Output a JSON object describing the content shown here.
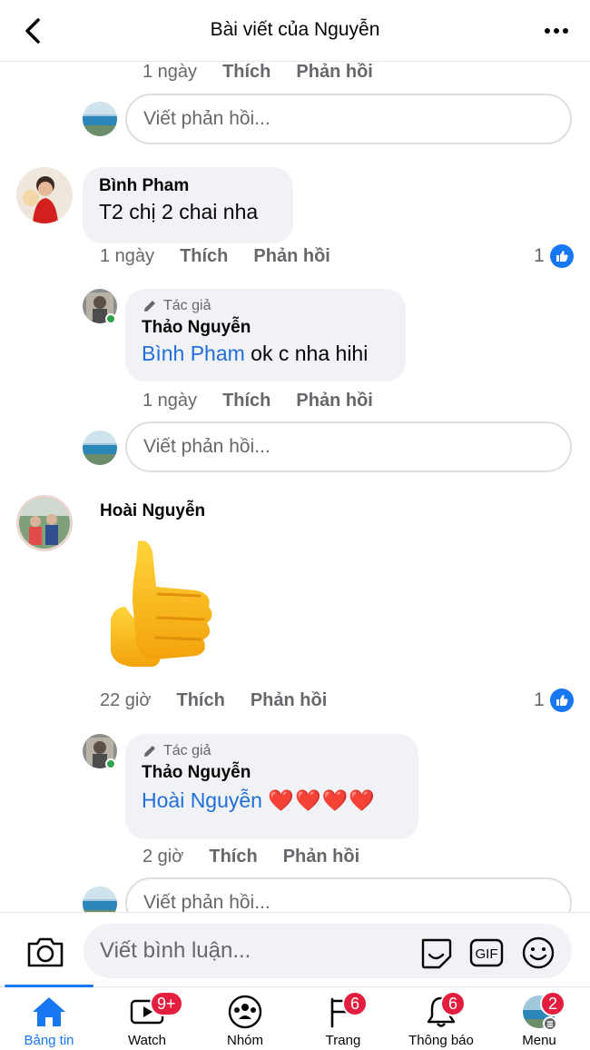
{
  "header": {
    "title": "Bài viết của Nguyễn"
  },
  "thread": {
    "top_meta": {
      "time": "1 ngày",
      "like": "Thích",
      "reply": "Phản hồi"
    },
    "reply_placeholder": "Viết phản hồi...",
    "comment1": {
      "name": "Bình Pham",
      "text": "T2 chị 2 chai nha",
      "time": "1 ngày",
      "like": "Thích",
      "reply": "Phản hồi",
      "like_count": "1"
    },
    "reply1": {
      "badge": "Tác giả",
      "name": "Thảo Nguyễn",
      "mention": "Bình Pham",
      "text": " ok c nha hihi",
      "time": "1 ngày",
      "like": "Thích",
      "reply": "Phản hồi"
    },
    "comment2": {
      "name": "Hoài Nguyễn",
      "time": "22 giờ",
      "like": "Thích",
      "reply": "Phản hồi",
      "like_count": "1"
    },
    "reply2": {
      "badge": "Tác giả",
      "name": "Thảo Nguyễn",
      "mention": "Hoài Nguyễn",
      "hearts": "❤️❤️❤️❤️",
      "time": "2 giờ",
      "like": "Thích",
      "reply": "Phản hồi"
    }
  },
  "composer": {
    "placeholder": "Viết bình luận...",
    "gif_label": "GIF"
  },
  "nav": {
    "tabs": [
      {
        "label": "Bảng tin",
        "badge": ""
      },
      {
        "label": "Watch",
        "badge": "9+"
      },
      {
        "label": "Nhóm",
        "badge": ""
      },
      {
        "label": "Trang",
        "badge": "6"
      },
      {
        "label": "Thông báo",
        "badge": "6"
      },
      {
        "label": "Menu",
        "badge": "2"
      }
    ]
  },
  "colors": {
    "accent": "#1877f2",
    "badge": "#e41e3f",
    "mention": "#216fdb",
    "bubble": "#f0f2f5",
    "online": "#31a24c"
  }
}
